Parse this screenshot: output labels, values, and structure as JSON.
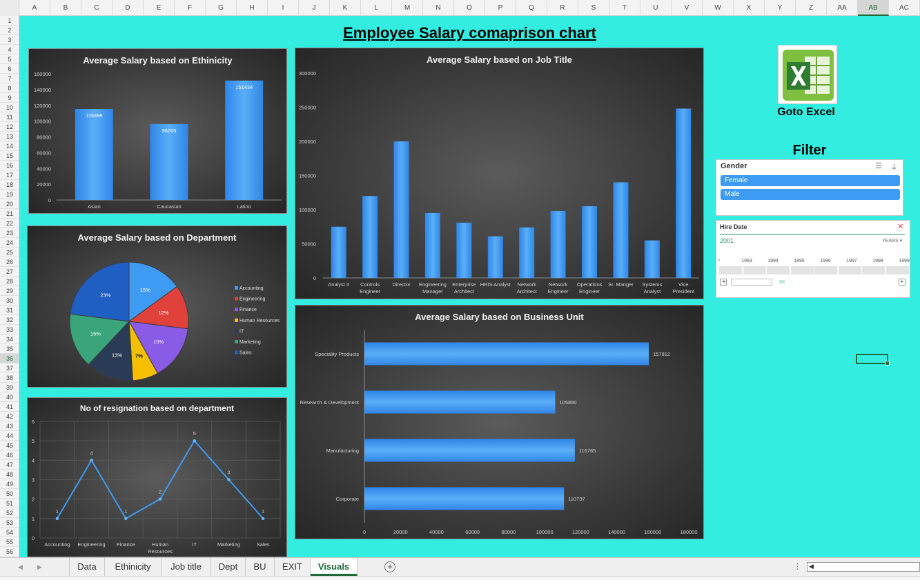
{
  "sheet": {
    "columns": [
      "A",
      "B",
      "C",
      "D",
      "E",
      "F",
      "G",
      "H",
      "I",
      "J",
      "K",
      "L",
      "M",
      "N",
      "O",
      "P",
      "Q",
      "R",
      "S",
      "T",
      "U",
      "V",
      "W",
      "X",
      "Y",
      "Z",
      "AA",
      "AB",
      "AC"
    ],
    "selected_column": "AB",
    "rows": [
      "1",
      "2",
      "3",
      "4",
      "5",
      "6",
      "7",
      "8",
      "9",
      "10",
      "11",
      "12",
      "13",
      "14",
      "15",
      "16",
      "17",
      "18",
      "19",
      "20",
      "21",
      "22",
      "23",
      "24",
      "25",
      "26",
      "27",
      "28",
      "29",
      "30",
      "31",
      "32",
      "33",
      "34",
      "35",
      "36",
      "37",
      "38",
      "39",
      "40",
      "41",
      "42",
      "43",
      "44",
      "45",
      "46",
      "47",
      "48",
      "49",
      "50",
      "51",
      "52",
      "53",
      "54",
      "55",
      "56"
    ],
    "selected_row": "36"
  },
  "dashboard": {
    "title": "Employee Salary comaprison chart",
    "goto_excel": "Goto Excel",
    "filter_title": "Filter"
  },
  "gender_slicer": {
    "header": "Gender",
    "items": [
      "Female",
      "Male"
    ],
    "icons": [
      "multi-select-icon",
      "clear-filter-icon"
    ]
  },
  "hire_slicer": {
    "header": "Hire Date",
    "selection": "2001",
    "level": "YEARS",
    "years": [
      "1993",
      "1994",
      "1995",
      "1996",
      "1997",
      "1998",
      "1999"
    ]
  },
  "tabs": {
    "items": [
      "Data",
      "Ethinicity",
      "Job title",
      "Dept",
      "BU",
      "EXIT",
      "Visuals"
    ],
    "active": "Visuals",
    "add_icon": "add-sheet-icon"
  },
  "colors": {
    "canvas": "#33ede0",
    "bar": "#3d9bf3",
    "chart_bg": "#3a3a3a",
    "excel_green": "#1e6b39"
  },
  "chart_data": [
    {
      "id": "ethnicity",
      "type": "bar",
      "title": "Average Salary based on Ethinicity",
      "categories": [
        "Asian",
        "Caucasian",
        "Latino"
      ],
      "values": [
        115398,
        96205,
        151434
      ],
      "data_labels": [
        "115398",
        "96205",
        "151434"
      ],
      "yticks": [
        "0",
        "20000",
        "40000",
        "60000",
        "80000",
        "100000",
        "120000",
        "140000",
        "160000"
      ],
      "ylim": [
        0,
        160000
      ]
    },
    {
      "id": "jobtitle",
      "type": "bar",
      "title": "Average Salary based on Job Title",
      "categories": [
        "Analyst II",
        "Controls Engineer",
        "Director",
        "Engineering Manager",
        "Enterprise Architect",
        "HRIS Analyst",
        "Network Architect",
        "Network Engineer",
        "Operations Engineer",
        "Sr. Manger",
        "Systems Analyst",
        "Vice President"
      ],
      "category_lines": [
        [
          "Analyst II"
        ],
        [
          "Controls",
          "Engineer"
        ],
        [
          "Director"
        ],
        [
          "Engineering",
          "Manager"
        ],
        [
          "Enterprise",
          "Architect"
        ],
        [
          "HRIS Analyst"
        ],
        [
          "Network",
          "Architect"
        ],
        [
          "Network",
          "Engineer"
        ],
        [
          "Operations",
          "Engineer"
        ],
        [
          "Sr. Manger"
        ],
        [
          "Systems",
          "Analyst"
        ],
        [
          "Vice",
          "President"
        ]
      ],
      "values": [
        75000,
        120000,
        200000,
        95000,
        81000,
        61000,
        74000,
        98000,
        105000,
        140000,
        55000,
        248000
      ],
      "yticks": [
        "0",
        "50000",
        "100000",
        "150000",
        "200000",
        "250000",
        "300000"
      ],
      "ylim": [
        0,
        300000
      ]
    },
    {
      "id": "department",
      "type": "pie",
      "title": "Average Salary based on Department",
      "categories": [
        "Accounting",
        "Engineering",
        "Finance",
        "Human Resources",
        "IT",
        "Marketing",
        "Sales"
      ],
      "values": [
        15,
        12,
        15,
        7,
        13,
        15,
        23
      ],
      "data_labels": [
        "15%",
        "12%",
        "15%",
        "7%",
        "13%",
        "15%",
        "23%"
      ],
      "colors": [
        "#3d9bf3",
        "#e0413a",
        "#8a5ce6",
        "#f6c000",
        "#2a3b55",
        "#3aa57a",
        "#1f5fc4"
      ],
      "legend": "right"
    },
    {
      "id": "resignation",
      "type": "line",
      "title": "No of resignation based on department",
      "categories": [
        "Accounting",
        "Engineering",
        "Finance",
        "Human Resources",
        "IT",
        "Marketing",
        "Sales"
      ],
      "category_lines": [
        [
          "Accounting"
        ],
        [
          "Engineering"
        ],
        [
          "Finance"
        ],
        [
          "Human",
          "Resources"
        ],
        [
          "IT"
        ],
        [
          "Marketing"
        ],
        [
          "Sales"
        ]
      ],
      "values": [
        1,
        4,
        1,
        2,
        5,
        3,
        1
      ],
      "data_labels": [
        "1",
        "4",
        "1",
        "2",
        "5",
        "3",
        "1"
      ],
      "yticks": [
        "0",
        "1",
        "2",
        "3",
        "4",
        "5",
        "6"
      ],
      "ylim": [
        0,
        6
      ],
      "grid": true
    },
    {
      "id": "businessunit",
      "type": "bar",
      "orientation": "horizontal",
      "title": "Average Salary based on Business Unit",
      "categories": [
        "Speciality Products",
        "Research & Development",
        "Manufacturing",
        "Corporate"
      ],
      "values": [
        157812,
        105890,
        116765,
        110737
      ],
      "data_labels": [
        "157812",
        "105890",
        "116765",
        "110737"
      ],
      "xticks": [
        "0",
        "20000",
        "40000",
        "60000",
        "80000",
        "100000",
        "120000",
        "140000",
        "160000",
        "180000"
      ],
      "xlim": [
        0,
        180000
      ]
    }
  ]
}
